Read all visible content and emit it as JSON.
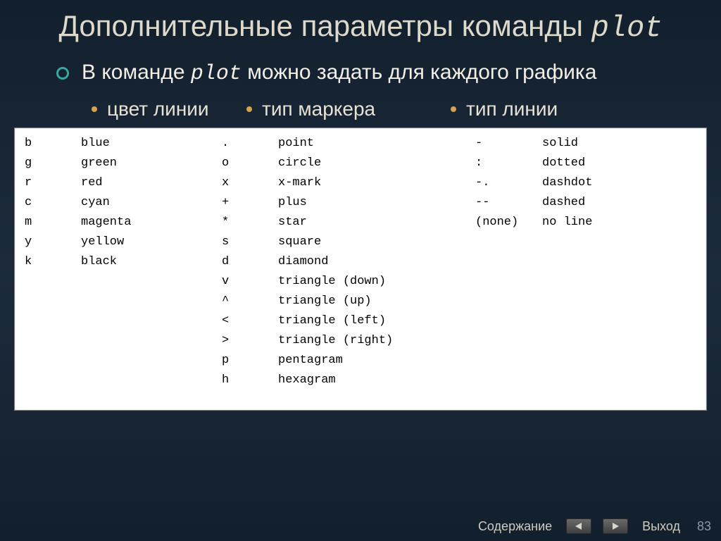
{
  "title": {
    "prefix": "Дополнительные параметры команды ",
    "code": "plot"
  },
  "main_point": {
    "before": "В команде ",
    "code": "plot",
    "after": " можно задать для каждого графика"
  },
  "sub_headers": {
    "color": "цвет линии",
    "marker": "тип маркера",
    "line": "тип линии"
  },
  "table": {
    "colors": [
      {
        "code": "b",
        "name": "blue"
      },
      {
        "code": "g",
        "name": "green"
      },
      {
        "code": "r",
        "name": "red"
      },
      {
        "code": "c",
        "name": "cyan"
      },
      {
        "code": "m",
        "name": "magenta"
      },
      {
        "code": "y",
        "name": "yellow"
      },
      {
        "code": "k",
        "name": "black"
      }
    ],
    "markers": [
      {
        "code": ".",
        "name": "point"
      },
      {
        "code": "o",
        "name": "circle"
      },
      {
        "code": "x",
        "name": "x-mark"
      },
      {
        "code": "+",
        "name": "plus"
      },
      {
        "code": "*",
        "name": "star"
      },
      {
        "code": "s",
        "name": "square"
      },
      {
        "code": "d",
        "name": "diamond"
      },
      {
        "code": "v",
        "name": "triangle (down)"
      },
      {
        "code": "^",
        "name": "triangle (up)"
      },
      {
        "code": "<",
        "name": "triangle (left)"
      },
      {
        "code": ">",
        "name": "triangle (right)"
      },
      {
        "code": "p",
        "name": "pentagram"
      },
      {
        "code": "h",
        "name": "hexagram"
      }
    ],
    "lines": [
      {
        "code": "-",
        "name": "solid"
      },
      {
        "code": ":",
        "name": "dotted"
      },
      {
        "code": "-.",
        "name": "dashdot"
      },
      {
        "code": "--",
        "name": "dashed"
      },
      {
        "code": "(none)",
        "name": "no line"
      }
    ]
  },
  "footer": {
    "contents": "Содержание",
    "exit": "Выход",
    "page": "83"
  }
}
